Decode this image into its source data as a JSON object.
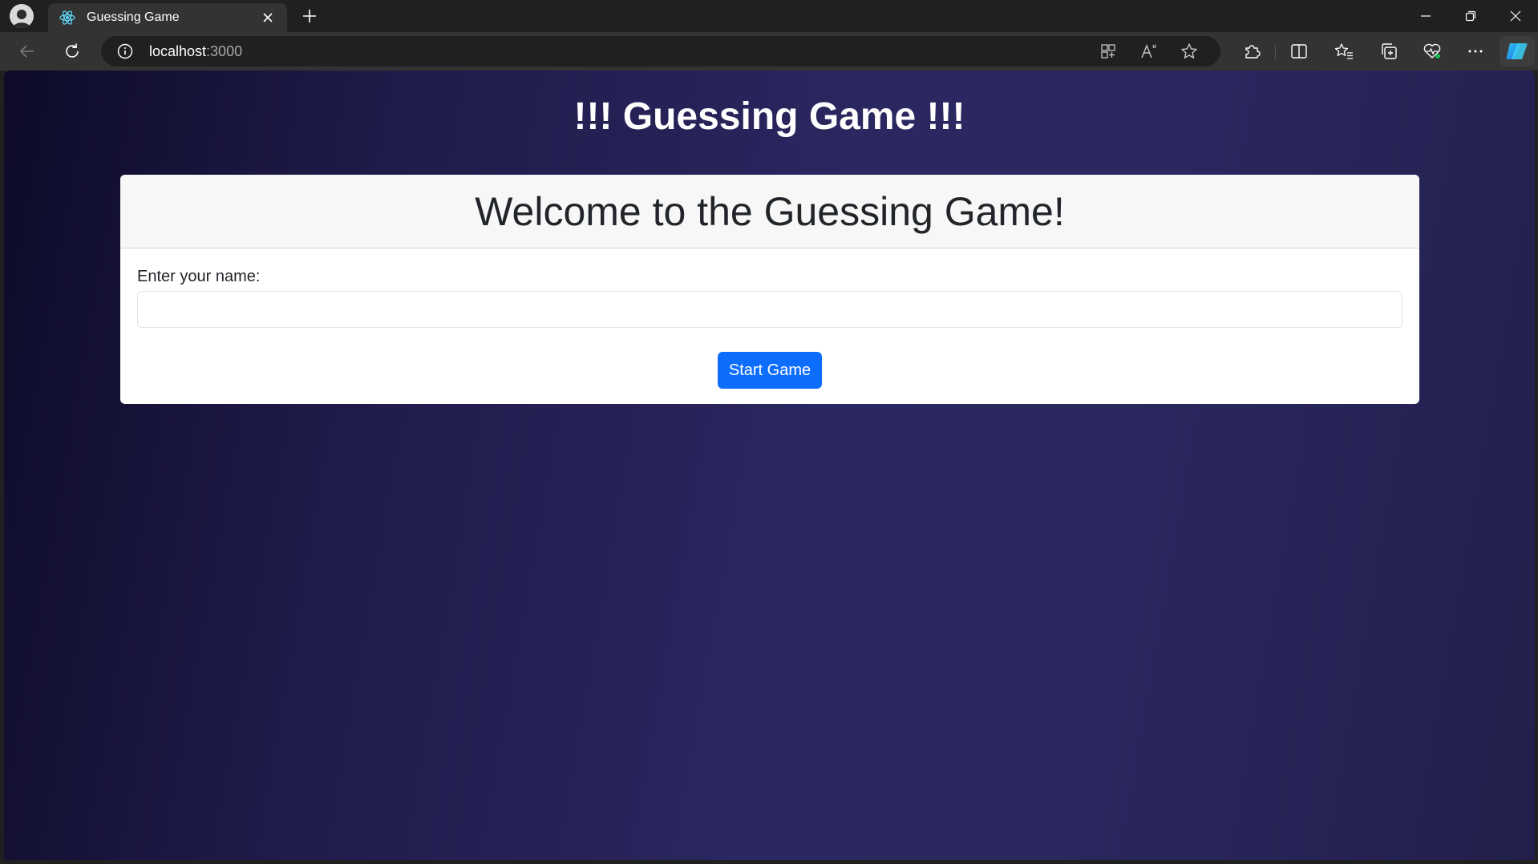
{
  "browser": {
    "tab": {
      "title": "Guessing Game",
      "favicon": "react-icon"
    },
    "address": {
      "host": "localhost",
      "port": ":3000"
    }
  },
  "page": {
    "heading": "!!! Guessing Game !!!",
    "card": {
      "title": "Welcome to the Guessing Game!",
      "name_label": "Enter your name:",
      "name_value": "",
      "start_button": "Start Game"
    }
  },
  "colors": {
    "accent": "#0d6efd",
    "bg_gradient_dark": "#0d0b28",
    "bg_gradient_mid": "#2b2760"
  }
}
